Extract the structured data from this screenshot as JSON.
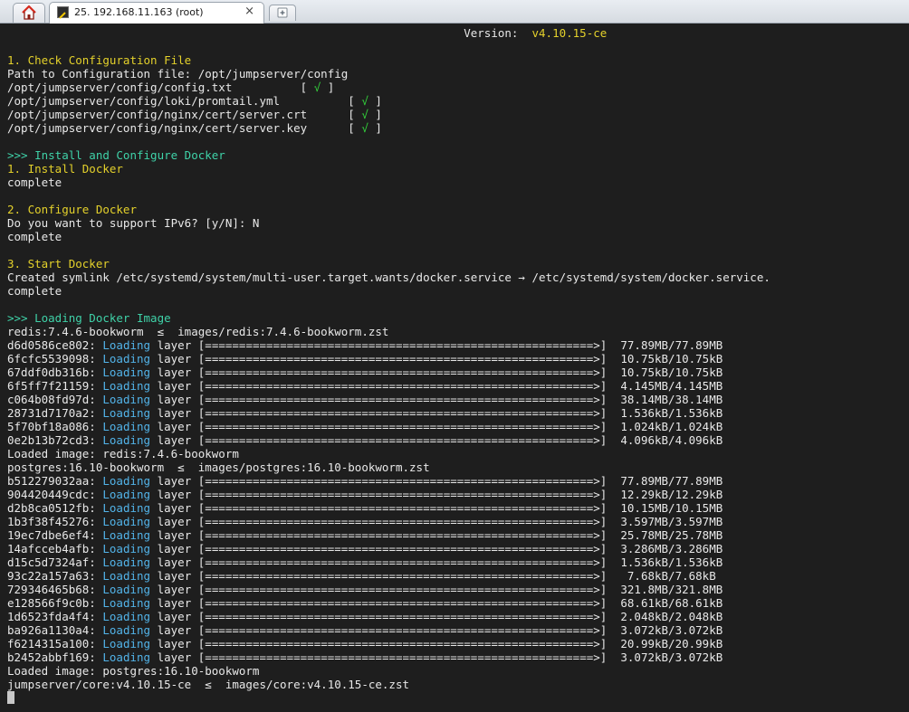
{
  "tabs": {
    "session_title": "25. 192.168.11.163 (root)",
    "close_glyph": "×",
    "icons": {
      "home": "home-icon",
      "session": "terminal-icon",
      "new_tab": "new-tab-icon"
    }
  },
  "colors": {
    "terminal_bg": "#1e1e1e",
    "heading": "#e4d12b",
    "section": "#3fd2a8",
    "ok_mark": "#33d13b",
    "loading": "#52b3e8"
  },
  "terminal": {
    "version_label": "Version:",
    "version_value": "v4.10.15-ce",
    "check_config": {
      "heading": "1. Check Configuration File",
      "path_line": "Path to Configuration file: /opt/jumpserver/config",
      "files": [
        {
          "path": "/opt/jumpserver/config/config.txt",
          "pad": "          ",
          "mark": "√"
        },
        {
          "path": "/opt/jumpserver/config/loki/promtail.yml",
          "pad": "          ",
          "mark": "√"
        },
        {
          "path": "/opt/jumpserver/config/nginx/cert/server.crt",
          "pad": "      ",
          "mark": "√"
        },
        {
          "path": "/opt/jumpserver/config/nginx/cert/server.key",
          "pad": "      ",
          "mark": "√"
        }
      ]
    },
    "docker": {
      "heading": ">>> Install and Configure Docker",
      "install_heading": "1. Install Docker",
      "install_status": "complete",
      "configure_heading": "2. Configure Docker",
      "ipv6_prompt": "Do you want to support IPv6? [y/N]: N",
      "configure_status": "complete",
      "start_heading": "3. Start Docker",
      "symlink_line": "Created symlink /etc/systemd/system/multi-user.target.wants/docker.service → /etc/systemd/system/docker.service.",
      "start_status": "complete"
    },
    "images": {
      "heading": ">>> Loading Docker Image",
      "loading_word": "Loading",
      "layer_word": "layer",
      "groups": [
        {
          "source": "redis:7.4.6-bookworm  ≤  images/redis:7.4.6-bookworm.zst",
          "layers": [
            {
              "id": "d6d0586ce802:",
              "size": "77.89MB/77.89MB"
            },
            {
              "id": "6fcfc5539098:",
              "size": "10.75kB/10.75kB"
            },
            {
              "id": "67ddf0db316b:",
              "size": "10.75kB/10.75kB"
            },
            {
              "id": "6f5ff7f21159:",
              "size": "4.145MB/4.145MB"
            },
            {
              "id": "c064b08fd97d:",
              "size": "38.14MB/38.14MB"
            },
            {
              "id": "28731d7170a2:",
              "size": "1.536kB/1.536kB"
            },
            {
              "id": "5f70bf18a086:",
              "size": "1.024kB/1.024kB"
            },
            {
              "id": "0e2b13b72cd3:",
              "size": "4.096kB/4.096kB"
            }
          ],
          "loaded": "Loaded image: redis:7.4.6-bookworm"
        },
        {
          "source": "postgres:16.10-bookworm  ≤  images/postgres:16.10-bookworm.zst",
          "layers": [
            {
              "id": "b512279032aa:",
              "size": "77.89MB/77.89MB"
            },
            {
              "id": "904420449cdc:",
              "size": "12.29kB/12.29kB"
            },
            {
              "id": "d2b8ca0512fb:",
              "size": "10.15MB/10.15MB"
            },
            {
              "id": "1b3f38f45276:",
              "size": "3.597MB/3.597MB"
            },
            {
              "id": "19ec7dbe6ef4:",
              "size": "25.78MB/25.78MB"
            },
            {
              "id": "14afcceb4afb:",
              "size": "3.286MB/3.286MB"
            },
            {
              "id": "d15c5d7324af:",
              "size": "1.536kB/1.536kB"
            },
            {
              "id": "93c22a157a63:",
              "size": " 7.68kB/7.68kB"
            },
            {
              "id": "729346465b68:",
              "size": "321.8MB/321.8MB"
            },
            {
              "id": "e128566f9c0b:",
              "size": "68.61kB/68.61kB"
            },
            {
              "id": "1d6523fda4f4:",
              "size": "2.048kB/2.048kB"
            },
            {
              "id": "ba926a1130a4:",
              "size": "3.072kB/3.072kB"
            },
            {
              "id": "f6214315a100:",
              "size": "20.99kB/20.99kB"
            },
            {
              "id": "b2452abbf169:",
              "size": "3.072kB/3.072kB"
            }
          ],
          "loaded": "Loaded image: postgres:16.10-bookworm"
        }
      ],
      "current": "jumpserver/core:v4.10.15-ce  ≤  images/core:v4.10.15-ce.zst"
    }
  }
}
